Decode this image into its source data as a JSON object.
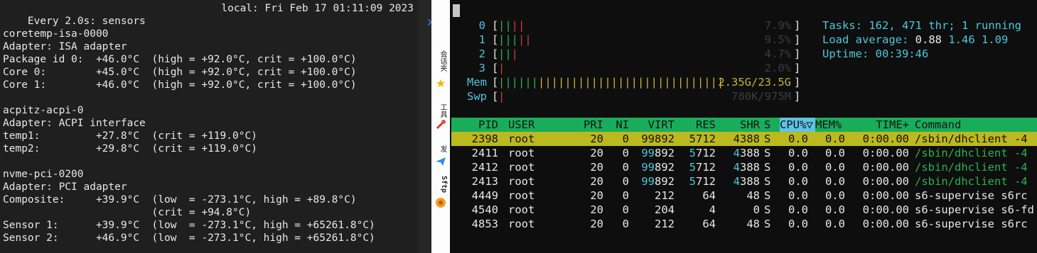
{
  "left": {
    "header_left": "Every 2.0s: sensors",
    "header_right": "local: Fri Feb 17 01:11:09 2023",
    "lines": [
      "coretemp-isa-0000",
      "Adapter: ISA adapter",
      "Package id 0:  +46.0°C  (high = +92.0°C, crit = +100.0°C)",
      "Core 0:        +45.0°C  (high = +92.0°C, crit = +100.0°C)",
      "Core 1:        +46.0°C  (high = +92.0°C, crit = +100.0°C)",
      "",
      "acpitz-acpi-0",
      "Adapter: ACPI interface",
      "temp1:         +27.8°C  (crit = +119.0°C)",
      "temp2:         +29.8°C  (crit = +119.0°C)",
      "",
      "nvme-pci-0200",
      "Adapter: PCI adapter",
      "Composite:     +39.9°C  (low  = -273.1°C, high = +89.8°C)",
      "                        (crit = +94.8°C)",
      "Sensor 1:      +39.9°C  (low  = -273.1°C, high = +65261.8°C)",
      "Sensor 2:      +46.9°C  (low  = -273.1°C, high = +65261.8°C)"
    ]
  },
  "toolbar": {
    "chevron": "»",
    "label_1": "会话夹",
    "label_2": "工具",
    "label_3": "发",
    "label_4": "Sftp",
    "icons": [
      "star-icon",
      "tools-icon",
      "send-icon",
      "sftp-icon"
    ]
  },
  "htop": {
    "cpus": [
      {
        "id": "0",
        "pct": "7.9%",
        "bars": [
          [
            "green",
            "||"
          ],
          [
            "red",
            "||"
          ]
        ]
      },
      {
        "id": "1",
        "pct": "9.5%",
        "bars": [
          [
            "green",
            "|||"
          ],
          [
            "red",
            "||"
          ]
        ]
      },
      {
        "id": "2",
        "pct": "4.7%",
        "bars": [
          [
            "green",
            "||"
          ],
          [
            "red",
            "|"
          ]
        ]
      },
      {
        "id": "3",
        "pct": "2.0%",
        "bars": [
          [
            "red",
            "|"
          ]
        ]
      }
    ],
    "mem": {
      "label": "Mem",
      "value": "2.35G/23.5G"
    },
    "swp": {
      "label": "Swp",
      "value": "780K/975M"
    },
    "tasks_label": "Tasks: ",
    "tasks": "162",
    "thr": "471",
    "thr_label": " thr; ",
    "running": "1",
    "running_label": " running",
    "load_label": "Load average: ",
    "load1": "0.88",
    "load5": "1.46",
    "load15": "1.09",
    "uptime_label": "Uptime: ",
    "uptime": "00:39:46",
    "columns": [
      "PID",
      "USER",
      "PRI",
      "NI",
      "VIRT",
      "RES",
      "SHR",
      "S",
      "CPU%▽",
      "MEM%",
      "TIME+",
      "Command"
    ],
    "rows": [
      {
        "pid": "2398",
        "user": "root",
        "pri": "20",
        "ni": "0",
        "virt": "99892",
        "res": "5712",
        "shr": "4388",
        "s": "S",
        "cpu": "0.0",
        "mem": "0.0",
        "time": "0:00.00",
        "cmd": "/sbin/dhclient -4"
      },
      {
        "pid": "2411",
        "user": "root",
        "pri": "20",
        "ni": "0",
        "virt": "99892",
        "res": "5712",
        "shr": "4388",
        "s": "S",
        "cpu": "0.0",
        "mem": "0.0",
        "time": "0:00.00",
        "cmd": "/sbin/dhclient -4"
      },
      {
        "pid": "2412",
        "user": "root",
        "pri": "20",
        "ni": "0",
        "virt": "99892",
        "res": "5712",
        "shr": "4388",
        "s": "S",
        "cpu": "0.0",
        "mem": "0.0",
        "time": "0:00.00",
        "cmd": "/sbin/dhclient -4"
      },
      {
        "pid": "2413",
        "user": "root",
        "pri": "20",
        "ni": "0",
        "virt": "99892",
        "res": "5712",
        "shr": "4388",
        "s": "S",
        "cpu": "0.0",
        "mem": "0.0",
        "time": "0:00.00",
        "cmd": "/sbin/dhclient -4"
      },
      {
        "pid": "4449",
        "user": "root",
        "pri": "20",
        "ni": "0",
        "virt": "212",
        "res": "64",
        "shr": "48",
        "s": "S",
        "cpu": "0.0",
        "mem": "0.0",
        "time": "0:00.00",
        "cmd": "s6-supervise s6rc"
      },
      {
        "pid": "4540",
        "user": "root",
        "pri": "20",
        "ni": "0",
        "virt": "204",
        "res": "4",
        "shr": "0",
        "s": "S",
        "cpu": "0.0",
        "mem": "0.0",
        "time": "0:00.00",
        "cmd": "s6-supervise s6-fd"
      },
      {
        "pid": "4853",
        "user": "root",
        "pri": "20",
        "ni": "0",
        "virt": "212",
        "res": "64",
        "shr": "48",
        "s": "S",
        "cpu": "0.0",
        "mem": "0.0",
        "time": "0:00.00",
        "cmd": "s6-supervise s6rc"
      }
    ],
    "colors": {
      "green": "#2cb04e",
      "red": "#d23b3b",
      "cyan": "#4cc7dc",
      "header": "#19ad5b",
      "selected": "#bcb81f",
      "sort_col": "#5ec3e5"
    }
  }
}
